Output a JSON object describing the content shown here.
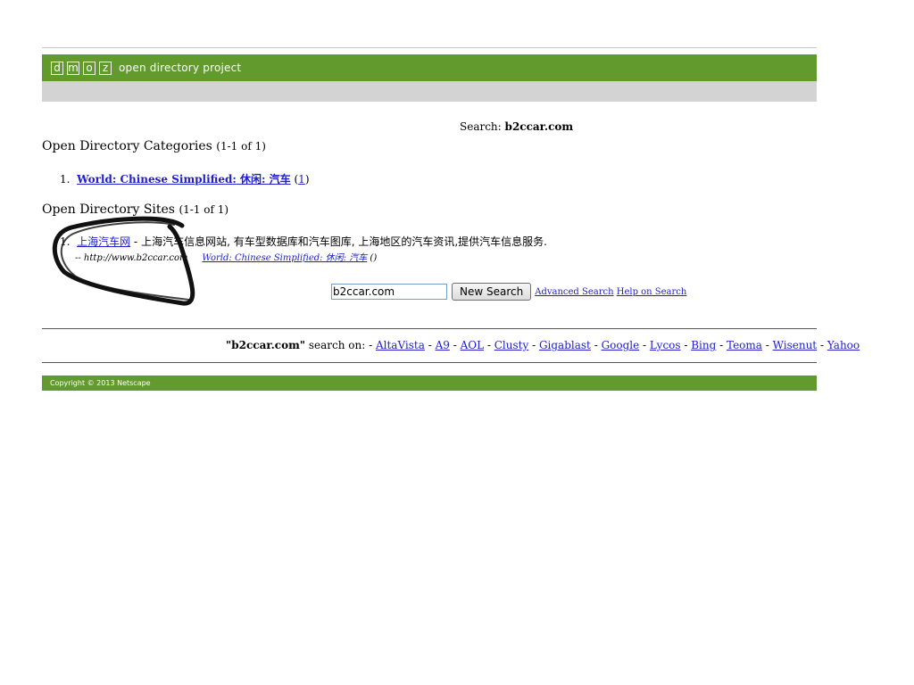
{
  "header": {
    "logo_letters": [
      "d",
      "m",
      "o",
      "z"
    ],
    "tagline": "open directory project",
    "bar_color": "#629a2e"
  },
  "search_echo": {
    "label": "Search:",
    "query": "b2ccar.com"
  },
  "categories": {
    "heading": "Open Directory Categories",
    "count": "(1-1 of 1)",
    "items": [
      {
        "number": "1.",
        "path": "World: Chinese Simplified:",
        "leaf": "休闲: 汽车",
        "count_open": "(",
        "count": "1",
        "count_close": ")"
      }
    ]
  },
  "sites": {
    "heading": "Open Directory Sites",
    "count": "(1-1 of 1)",
    "items": [
      {
        "number": "1.",
        "title": "上海汽车网",
        "description": " - 上海汽车信息网站, 有车型数据库和汽车图库, 上海地区的汽车资讯,提供汽车信息服务.",
        "url": "-- http://www.b2ccar.com",
        "category_link": "World: Chinese Simplified: 休闲: 汽车",
        "category_tail": "()"
      }
    ]
  },
  "search_form": {
    "input_value": "b2ccar.com",
    "button_label": "New Search",
    "advanced_link": "Advanced Search",
    "help_link": "Help on Search"
  },
  "other_engines": {
    "query": "\"b2ccar.com\"",
    "prefix": " search on: - ",
    "engines": [
      "AltaVista",
      "A9",
      "AOL",
      "Clusty",
      "Gigablast",
      "Google",
      "Lycos",
      "Bing",
      "Teoma",
      "Wisenut",
      "Yahoo"
    ]
  },
  "footer": {
    "copyright": "Copyright © 2013 Netscape"
  }
}
